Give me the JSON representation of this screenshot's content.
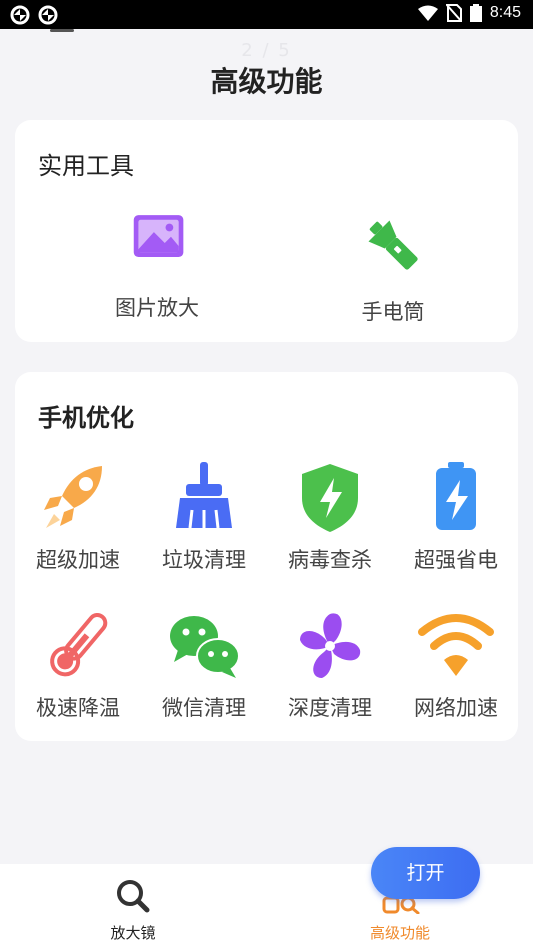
{
  "status_bar": {
    "time": "8:45"
  },
  "page_indicator": "2 / 5",
  "page_title": "高级功能",
  "tools_card": {
    "title": "实用工具",
    "items": [
      {
        "label": "图片放大",
        "icon": "image-icon",
        "color": "#a35bf5"
      },
      {
        "label": "手电筒",
        "icon": "flashlight-icon",
        "color": "#3fb84a"
      }
    ]
  },
  "optimize_card": {
    "title": "手机优化",
    "items": [
      {
        "label": "超级加速",
        "icon": "rocket-icon",
        "color": "#f8a94a"
      },
      {
        "label": "垃圾清理",
        "icon": "broom-icon",
        "color": "#4a6cf4"
      },
      {
        "label": "病毒查杀",
        "icon": "shield-icon",
        "color": "#4cc04c"
      },
      {
        "label": "超强省电",
        "icon": "battery-icon",
        "color": "#3f95f4"
      },
      {
        "label": "极速降温",
        "icon": "thermometer-icon",
        "color": "#f06666"
      },
      {
        "label": "微信清理",
        "icon": "wechat-icon",
        "color": "#3fb84a"
      },
      {
        "label": "深度清理",
        "icon": "fan-icon",
        "color": "#9b4df0"
      },
      {
        "label": "网络加速",
        "icon": "wifi-icon",
        "color": "#f6a12b"
      }
    ]
  },
  "bottom_nav": {
    "items": [
      {
        "label": "放大镜",
        "icon": "magnifier-icon",
        "active": false
      },
      {
        "label": "高级功能",
        "icon": "advanced-icon",
        "active": true
      }
    ],
    "active_color": "#f08a2c"
  },
  "open_button": {
    "label": "打开"
  }
}
